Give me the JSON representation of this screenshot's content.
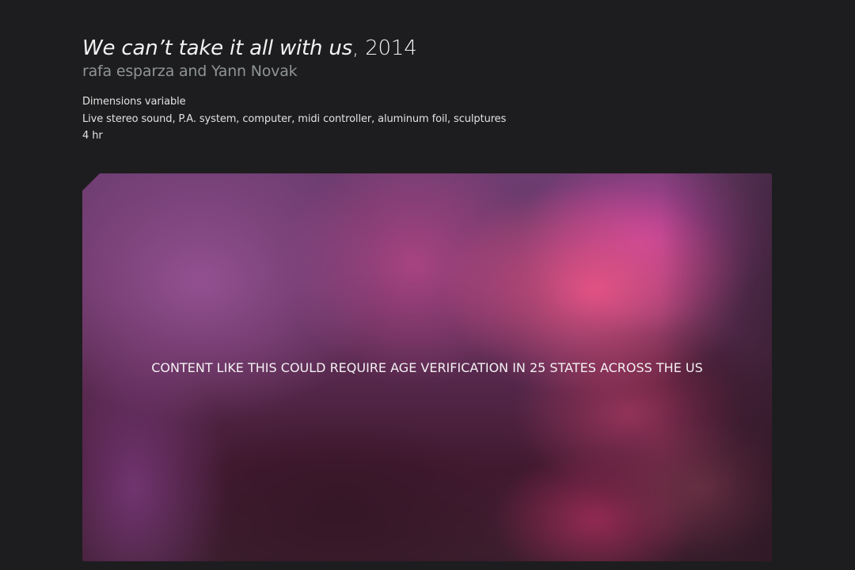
{
  "artwork": {
    "title": "We can’t take it all with us",
    "year_separator": ",",
    "year": "2014",
    "artists": "rafa esparza and Yann Novak",
    "details": [
      "Dimensions variable",
      "Live stereo sound, P.A. system, computer, midi controller, aluminum foil, sculptures",
      "4 hr"
    ]
  },
  "media": {
    "overlay_text": "CONTENT LIKE THIS COULD REQUIRE AGE VERIFICATION IN 25 STATES ACROSS THE US"
  },
  "colors": {
    "page_background": "#1d1d1f",
    "title_text": "#f2f2f2",
    "artists_text": "#8f9493",
    "overlay_text": "#f4f0f2",
    "blur_accent_pink": "#e85484",
    "blur_accent_purple": "#965294"
  }
}
